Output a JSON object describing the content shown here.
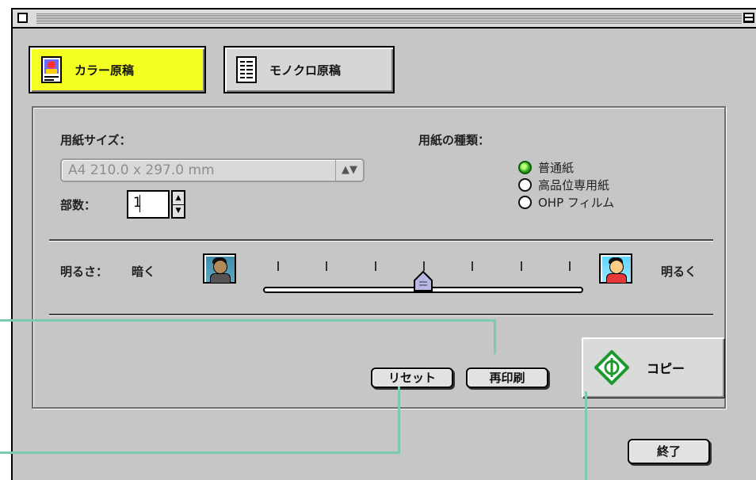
{
  "colors": {
    "accent_tab": "#f4ff22",
    "callout_line": "#7ccab0",
    "radio_selected": "#2ca01a",
    "copy_icon": "#1d9a2d"
  },
  "tabs": [
    {
      "label": "カラー原稿",
      "icon": "color-original-icon",
      "selected": true
    },
    {
      "label": "モノクロ原稿",
      "icon": "mono-original-icon",
      "selected": false
    }
  ],
  "paper_size": {
    "label": "用紙サイズ：",
    "value": "A4 210.0 x 297.0 mm"
  },
  "copies": {
    "label": "部数：",
    "value": "1"
  },
  "paper_type": {
    "label": "用紙の種類：",
    "options": [
      "普通紙",
      "高品位専用紙",
      "OHP フィルム"
    ],
    "selected_index": 0
  },
  "brightness": {
    "label": "明るさ：",
    "dark_label": "暗く",
    "light_label": "明るく",
    "level": 0.5,
    "ticks": 7
  },
  "buttons": {
    "reset": "リセット",
    "reprint": "再印刷",
    "copy": "コピー",
    "quit": "終了"
  }
}
